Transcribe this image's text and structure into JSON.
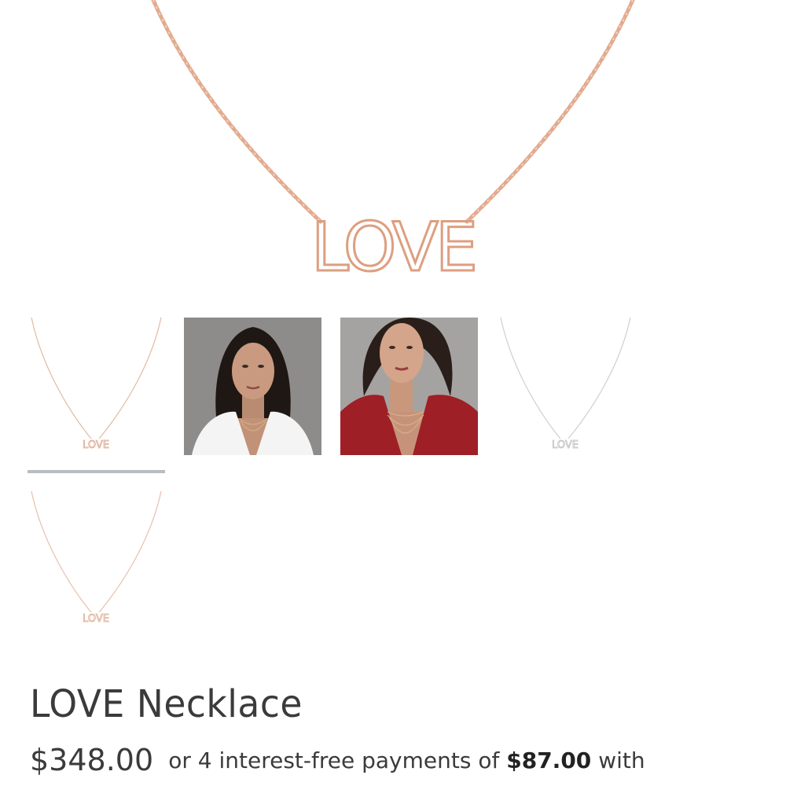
{
  "product": {
    "name": "LOVE Necklace",
    "price": "$348.00",
    "installment_prefix": "or 4 interest-free payments of",
    "installment_amount": "$87.00",
    "installment_suffix": "with"
  },
  "hero": {
    "pendant_text": "LOVE",
    "metal_color": "#e0a88c"
  },
  "thumbnails": [
    {
      "kind": "necklace",
      "pendant_text": "LOVE",
      "metal_color": "#dcae94",
      "selected": true
    },
    {
      "kind": "model",
      "top_color": "#f4f4f4",
      "bg_color": "#8f8d8c"
    },
    {
      "kind": "model",
      "top_color": "#9e1f26",
      "bg_color": "#a3a19f"
    },
    {
      "kind": "necklace",
      "pendant_text": "LOVE",
      "metal_color": "#c9c9c9",
      "selected": false
    },
    {
      "kind": "necklace",
      "pendant_text": "LOVE",
      "metal_color": "#e4b39c",
      "selected": false
    }
  ]
}
